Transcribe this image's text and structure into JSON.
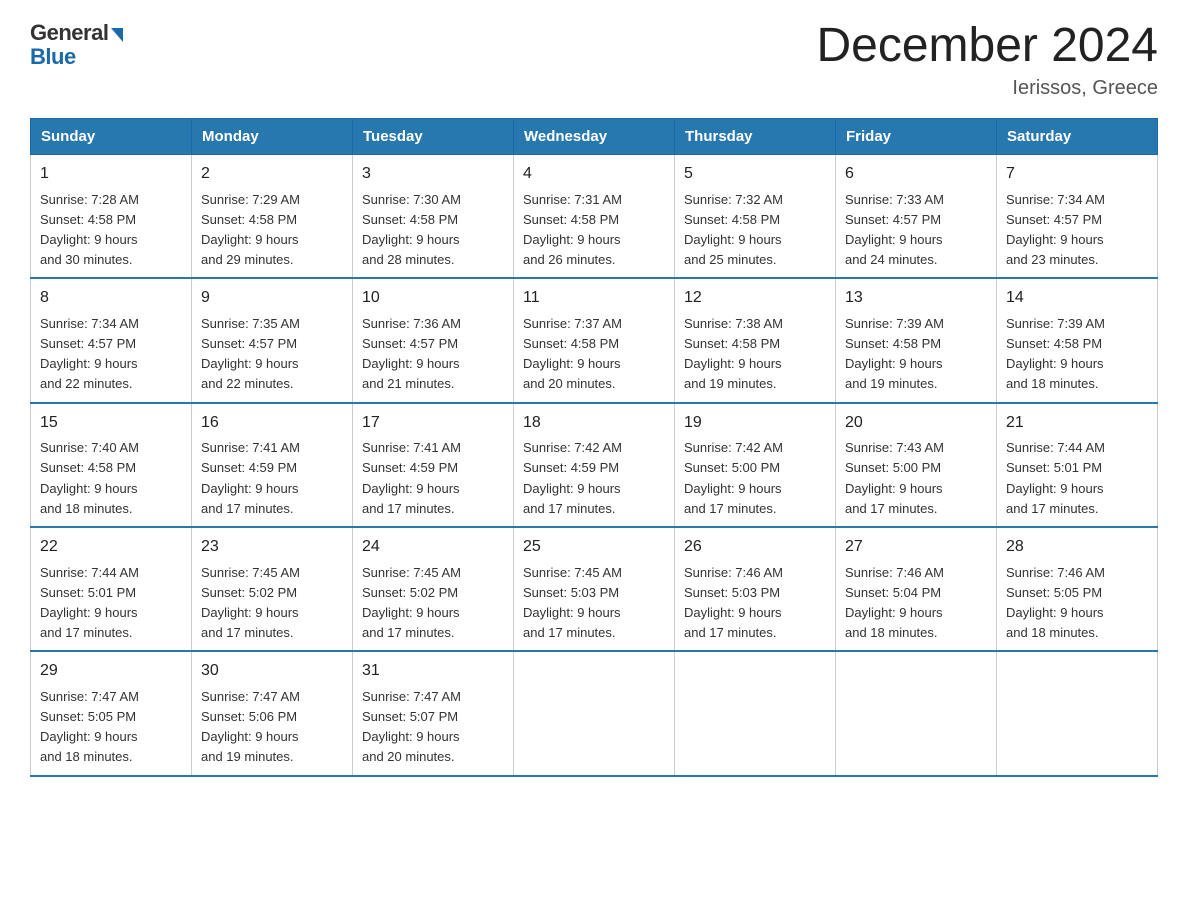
{
  "header": {
    "logo_general": "General",
    "logo_blue": "Blue",
    "month_title": "December 2024",
    "location": "Ierissos, Greece"
  },
  "weekdays": [
    "Sunday",
    "Monday",
    "Tuesday",
    "Wednesday",
    "Thursday",
    "Friday",
    "Saturday"
  ],
  "weeks": [
    [
      {
        "day": "1",
        "sunrise": "7:28 AM",
        "sunset": "4:58 PM",
        "daylight": "9 hours and 30 minutes."
      },
      {
        "day": "2",
        "sunrise": "7:29 AM",
        "sunset": "4:58 PM",
        "daylight": "9 hours and 29 minutes."
      },
      {
        "day": "3",
        "sunrise": "7:30 AM",
        "sunset": "4:58 PM",
        "daylight": "9 hours and 28 minutes."
      },
      {
        "day": "4",
        "sunrise": "7:31 AM",
        "sunset": "4:58 PM",
        "daylight": "9 hours and 26 minutes."
      },
      {
        "day": "5",
        "sunrise": "7:32 AM",
        "sunset": "4:58 PM",
        "daylight": "9 hours and 25 minutes."
      },
      {
        "day": "6",
        "sunrise": "7:33 AM",
        "sunset": "4:57 PM",
        "daylight": "9 hours and 24 minutes."
      },
      {
        "day": "7",
        "sunrise": "7:34 AM",
        "sunset": "4:57 PM",
        "daylight": "9 hours and 23 minutes."
      }
    ],
    [
      {
        "day": "8",
        "sunrise": "7:34 AM",
        "sunset": "4:57 PM",
        "daylight": "9 hours and 22 minutes."
      },
      {
        "day": "9",
        "sunrise": "7:35 AM",
        "sunset": "4:57 PM",
        "daylight": "9 hours and 22 minutes."
      },
      {
        "day": "10",
        "sunrise": "7:36 AM",
        "sunset": "4:57 PM",
        "daylight": "9 hours and 21 minutes."
      },
      {
        "day": "11",
        "sunrise": "7:37 AM",
        "sunset": "4:58 PM",
        "daylight": "9 hours and 20 minutes."
      },
      {
        "day": "12",
        "sunrise": "7:38 AM",
        "sunset": "4:58 PM",
        "daylight": "9 hours and 19 minutes."
      },
      {
        "day": "13",
        "sunrise": "7:39 AM",
        "sunset": "4:58 PM",
        "daylight": "9 hours and 19 minutes."
      },
      {
        "day": "14",
        "sunrise": "7:39 AM",
        "sunset": "4:58 PM",
        "daylight": "9 hours and 18 minutes."
      }
    ],
    [
      {
        "day": "15",
        "sunrise": "7:40 AM",
        "sunset": "4:58 PM",
        "daylight": "9 hours and 18 minutes."
      },
      {
        "day": "16",
        "sunrise": "7:41 AM",
        "sunset": "4:59 PM",
        "daylight": "9 hours and 17 minutes."
      },
      {
        "day": "17",
        "sunrise": "7:41 AM",
        "sunset": "4:59 PM",
        "daylight": "9 hours and 17 minutes."
      },
      {
        "day": "18",
        "sunrise": "7:42 AM",
        "sunset": "4:59 PM",
        "daylight": "9 hours and 17 minutes."
      },
      {
        "day": "19",
        "sunrise": "7:42 AM",
        "sunset": "5:00 PM",
        "daylight": "9 hours and 17 minutes."
      },
      {
        "day": "20",
        "sunrise": "7:43 AM",
        "sunset": "5:00 PM",
        "daylight": "9 hours and 17 minutes."
      },
      {
        "day": "21",
        "sunrise": "7:44 AM",
        "sunset": "5:01 PM",
        "daylight": "9 hours and 17 minutes."
      }
    ],
    [
      {
        "day": "22",
        "sunrise": "7:44 AM",
        "sunset": "5:01 PM",
        "daylight": "9 hours and 17 minutes."
      },
      {
        "day": "23",
        "sunrise": "7:45 AM",
        "sunset": "5:02 PM",
        "daylight": "9 hours and 17 minutes."
      },
      {
        "day": "24",
        "sunrise": "7:45 AM",
        "sunset": "5:02 PM",
        "daylight": "9 hours and 17 minutes."
      },
      {
        "day": "25",
        "sunrise": "7:45 AM",
        "sunset": "5:03 PM",
        "daylight": "9 hours and 17 minutes."
      },
      {
        "day": "26",
        "sunrise": "7:46 AM",
        "sunset": "5:03 PM",
        "daylight": "9 hours and 17 minutes."
      },
      {
        "day": "27",
        "sunrise": "7:46 AM",
        "sunset": "5:04 PM",
        "daylight": "9 hours and 18 minutes."
      },
      {
        "day": "28",
        "sunrise": "7:46 AM",
        "sunset": "5:05 PM",
        "daylight": "9 hours and 18 minutes."
      }
    ],
    [
      {
        "day": "29",
        "sunrise": "7:47 AM",
        "sunset": "5:05 PM",
        "daylight": "9 hours and 18 minutes."
      },
      {
        "day": "30",
        "sunrise": "7:47 AM",
        "sunset": "5:06 PM",
        "daylight": "9 hours and 19 minutes."
      },
      {
        "day": "31",
        "sunrise": "7:47 AM",
        "sunset": "5:07 PM",
        "daylight": "9 hours and 20 minutes."
      },
      null,
      null,
      null,
      null
    ]
  ],
  "labels": {
    "sunrise": "Sunrise:",
    "sunset": "Sunset:",
    "daylight": "Daylight:"
  }
}
